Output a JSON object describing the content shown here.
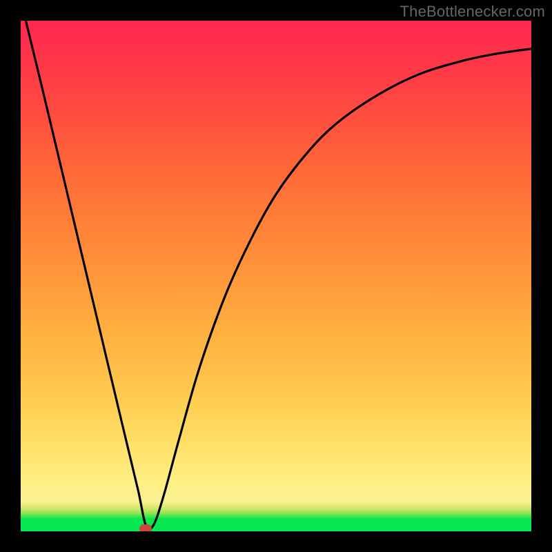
{
  "watermark": "TheBottlenecker.com",
  "chart_data": {
    "type": "line",
    "title": "",
    "xlabel": "",
    "ylabel": "",
    "xlim": [
      0,
      1
    ],
    "ylim": [
      0,
      1
    ],
    "x_min_point": 0.245,
    "series": [
      {
        "name": "curve",
        "points": [
          {
            "x": 0.01,
            "y": 1.0
          },
          {
            "x": 0.05,
            "y": 0.835
          },
          {
            "x": 0.1,
            "y": 0.625
          },
          {
            "x": 0.15,
            "y": 0.415
          },
          {
            "x": 0.2,
            "y": 0.205
          },
          {
            "x": 0.23,
            "y": 0.08
          },
          {
            "x": 0.245,
            "y": 0.012
          },
          {
            "x": 0.26,
            "y": 0.012
          },
          {
            "x": 0.28,
            "y": 0.07
          },
          {
            "x": 0.31,
            "y": 0.18
          },
          {
            "x": 0.35,
            "y": 0.32
          },
          {
            "x": 0.4,
            "y": 0.46
          },
          {
            "x": 0.45,
            "y": 0.57
          },
          {
            "x": 0.5,
            "y": 0.66
          },
          {
            "x": 0.56,
            "y": 0.74
          },
          {
            "x": 0.62,
            "y": 0.8
          },
          {
            "x": 0.7,
            "y": 0.855
          },
          {
            "x": 0.78,
            "y": 0.895
          },
          {
            "x": 0.86,
            "y": 0.92
          },
          {
            "x": 0.93,
            "y": 0.935
          },
          {
            "x": 1.0,
            "y": 0.945
          }
        ]
      }
    ],
    "marker": {
      "x": 0.245,
      "y": 0.005,
      "color": "#cf463e"
    },
    "gradient_stops": [
      {
        "pos": 0.0,
        "color": "#06e851"
      },
      {
        "pos": 0.05,
        "color": "#e8ea7a"
      },
      {
        "pos": 0.2,
        "color": "#ffda5e"
      },
      {
        "pos": 0.5,
        "color": "#ff973a"
      },
      {
        "pos": 0.8,
        "color": "#ff513e"
      },
      {
        "pos": 1.0,
        "color": "#ff2850"
      }
    ]
  }
}
